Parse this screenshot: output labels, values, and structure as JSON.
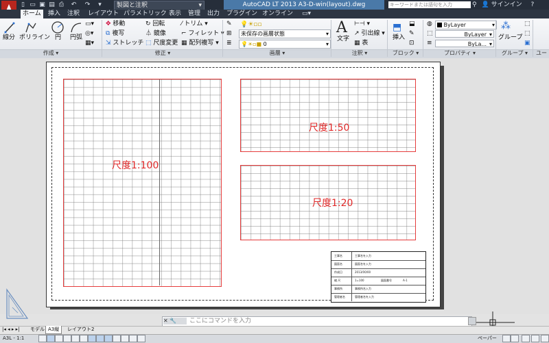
{
  "titlebar": {
    "workspace": "製図と注釈",
    "title": "AutoCAD LT 2013    A3-D-win(layout).dwg",
    "search_placeholder": "キーワードまたは語句を入力",
    "signin": "サインイン"
  },
  "ribbon_tabs": [
    "ホーム",
    "挿入",
    "注釈",
    "レイアウト",
    "パラメトリック",
    "表示",
    "管理",
    "出力",
    "プラグイン",
    "オンライン"
  ],
  "draw_panel": {
    "label": "作成",
    "line": "線分",
    "polyline": "ポリライン",
    "circle": "円",
    "arc": "円弧"
  },
  "modify_panel": {
    "label": "修正",
    "move": "移動",
    "rotate": "回転",
    "trim": "トリム",
    "copy": "複写",
    "mirror": "鏡像",
    "fillet": "フィレット",
    "stretch": "ストレッチ",
    "scale": "尺度変更",
    "array": "配列複写"
  },
  "layers_panel": {
    "label": "画層",
    "state": "未保存の画層状態",
    "current_layer": "0"
  },
  "annotation_panel": {
    "label": "注釈",
    "text": "文字",
    "leader": "引出線",
    "table": "表"
  },
  "block_panel": {
    "label": "ブロック",
    "insert": "挿入"
  },
  "properties_panel": {
    "label": "プロパティ",
    "color": "ByLayer",
    "linetype": "ByLayer",
    "lineweight": "ByLa..."
  },
  "groups_panel": {
    "label": "グループ",
    "group": "グループ"
  },
  "utilities_label": "ユー",
  "viewports": {
    "big_scale": "尺度1:100",
    "top_scale": "尺度1:50",
    "bottom_scale": "尺度1:20"
  },
  "title_block": {
    "rows": [
      {
        "key": "工事名",
        "value": "工事名を入力"
      },
      {
        "key": "図面名",
        "value": "図面名を入力"
      },
      {
        "key": "作成日",
        "value": "2013/00/00"
      },
      {
        "key": "縮  尺",
        "value": "1=100",
        "key2": "図面番号",
        "value2": "A-1"
      },
      {
        "key": "事務所",
        "value": "事務所名入力"
      },
      {
        "key": "管理者名",
        "value": "管理者名を入力"
      }
    ]
  },
  "command_line": {
    "placeholder": "ここにコマンドを入力"
  },
  "layout_tabs": [
    "モデル",
    "A3縦",
    "レイアウト2"
  ],
  "status": {
    "coords": "A3L - 1:1",
    "right": "ペーパー"
  },
  "colors": {
    "accent": "#4a79a8",
    "viewport_border": "#e63b3b",
    "scale_text": "#e02828"
  }
}
